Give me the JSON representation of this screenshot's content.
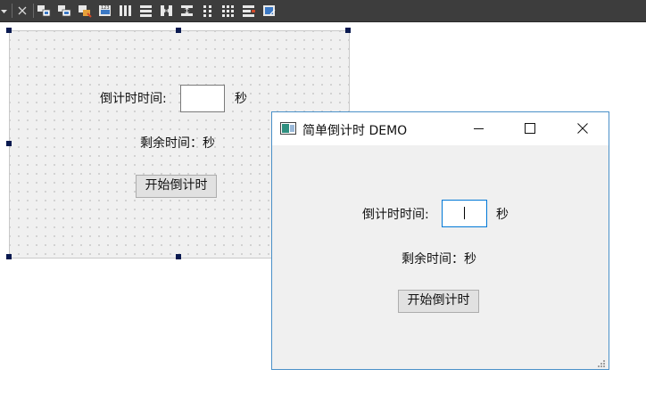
{
  "toolbar": {
    "items": [
      {
        "icon": "dropdown-arrow-icon"
      },
      {
        "icon": "close-icon"
      },
      {
        "icon": "align-lefts-icon"
      },
      {
        "icon": "align-tops-icon"
      },
      {
        "icon": "bring-to-front-icon"
      },
      {
        "icon": "tab-order-icon"
      },
      {
        "icon": "horizontal-layout-icon"
      },
      {
        "icon": "vertical-layout-icon"
      },
      {
        "icon": "horizontal-splitter-icon"
      },
      {
        "icon": "vertical-splitter-icon"
      },
      {
        "icon": "grid-layout-icon"
      },
      {
        "icon": "form-layout-icon"
      },
      {
        "icon": "break-layout-icon"
      },
      {
        "icon": "adjust-size-icon"
      }
    ]
  },
  "designer": {
    "countdown_label": "倒计时时间:",
    "input_value": "",
    "unit_label": "秒",
    "remaining_label": "剩余时间：秒",
    "start_button": "开始倒计时"
  },
  "window": {
    "title": "简单倒计时 DEMO",
    "countdown_label": "倒计时时间:",
    "input_value": "",
    "unit_label": "秒",
    "remaining_label": "剩余时间：秒",
    "start_button": "开始倒计时",
    "accent_color": "#0078d7",
    "border_color": "#4a90c8"
  }
}
